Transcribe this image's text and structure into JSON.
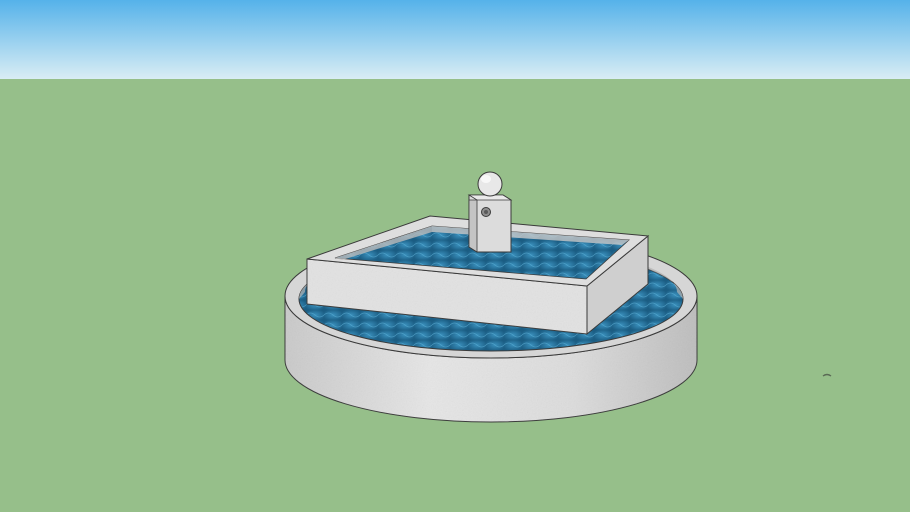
{
  "scene": {
    "sky_top": "#55b2ea",
    "sky_bottom": "#d9edf4",
    "ground": "#96bf8a",
    "stone": "#e4e4e4",
    "stone_shadow": "#b9b9b9",
    "water": "#2e7ea8",
    "water_dark": "#1b5d83",
    "edge": "#3a3a3a",
    "objects": [
      "fountain",
      "spout",
      "sphere-ornament",
      "upper-basin",
      "lower-basin"
    ]
  }
}
